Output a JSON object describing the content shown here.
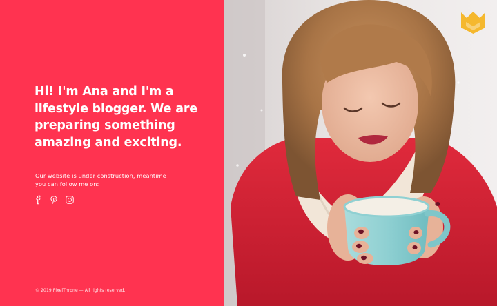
{
  "hero": {
    "headline": "Hi! I'm Ana and I'm a lifestyle blogger. We are preparing something amazing and exciting.",
    "subtext": "Our website is under construction, meantime you can follow me on:"
  },
  "social": [
    {
      "icon": "facebook-icon"
    },
    {
      "icon": "pinterest-icon"
    },
    {
      "icon": "instagram-icon"
    }
  ],
  "footer": {
    "copyright": "© 2019 PixelThrone — All rights reserved."
  },
  "colors": {
    "accent": "#ff3350",
    "logo": "#f5b82e",
    "text": "#ffffff"
  },
  "logo": {
    "icon": "crown-logo-icon"
  }
}
